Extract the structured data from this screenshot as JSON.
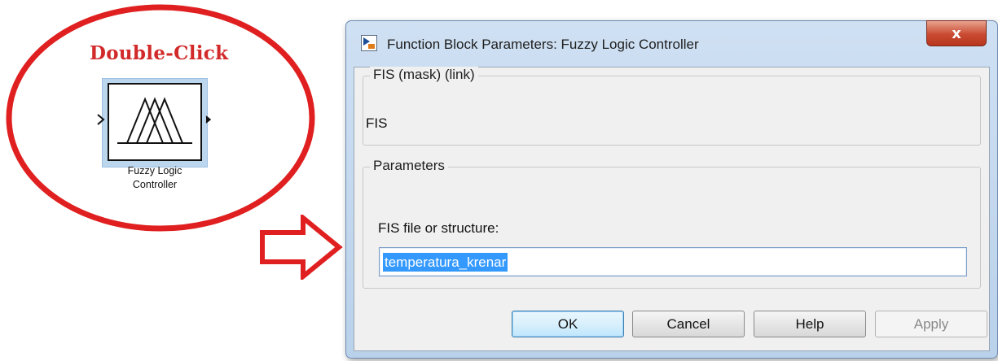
{
  "annotation": {
    "double_click_label": "Double-Click",
    "block_label_line1": "Fuzzy Logic",
    "block_label_line2": "Controller",
    "highlight_color": "#e02020"
  },
  "dialog": {
    "title": "Function Block Parameters: Fuzzy Logic Controller",
    "close_symbol": "x",
    "mask_group_label": "FIS (mask) (link)",
    "mask_description": "FIS",
    "params_group_label": "Parameters",
    "field_label": "FIS file or structure:",
    "field_value": "temperatura_krenar",
    "buttons": {
      "ok": "OK",
      "cancel": "Cancel",
      "help": "Help",
      "apply": "Apply"
    }
  }
}
